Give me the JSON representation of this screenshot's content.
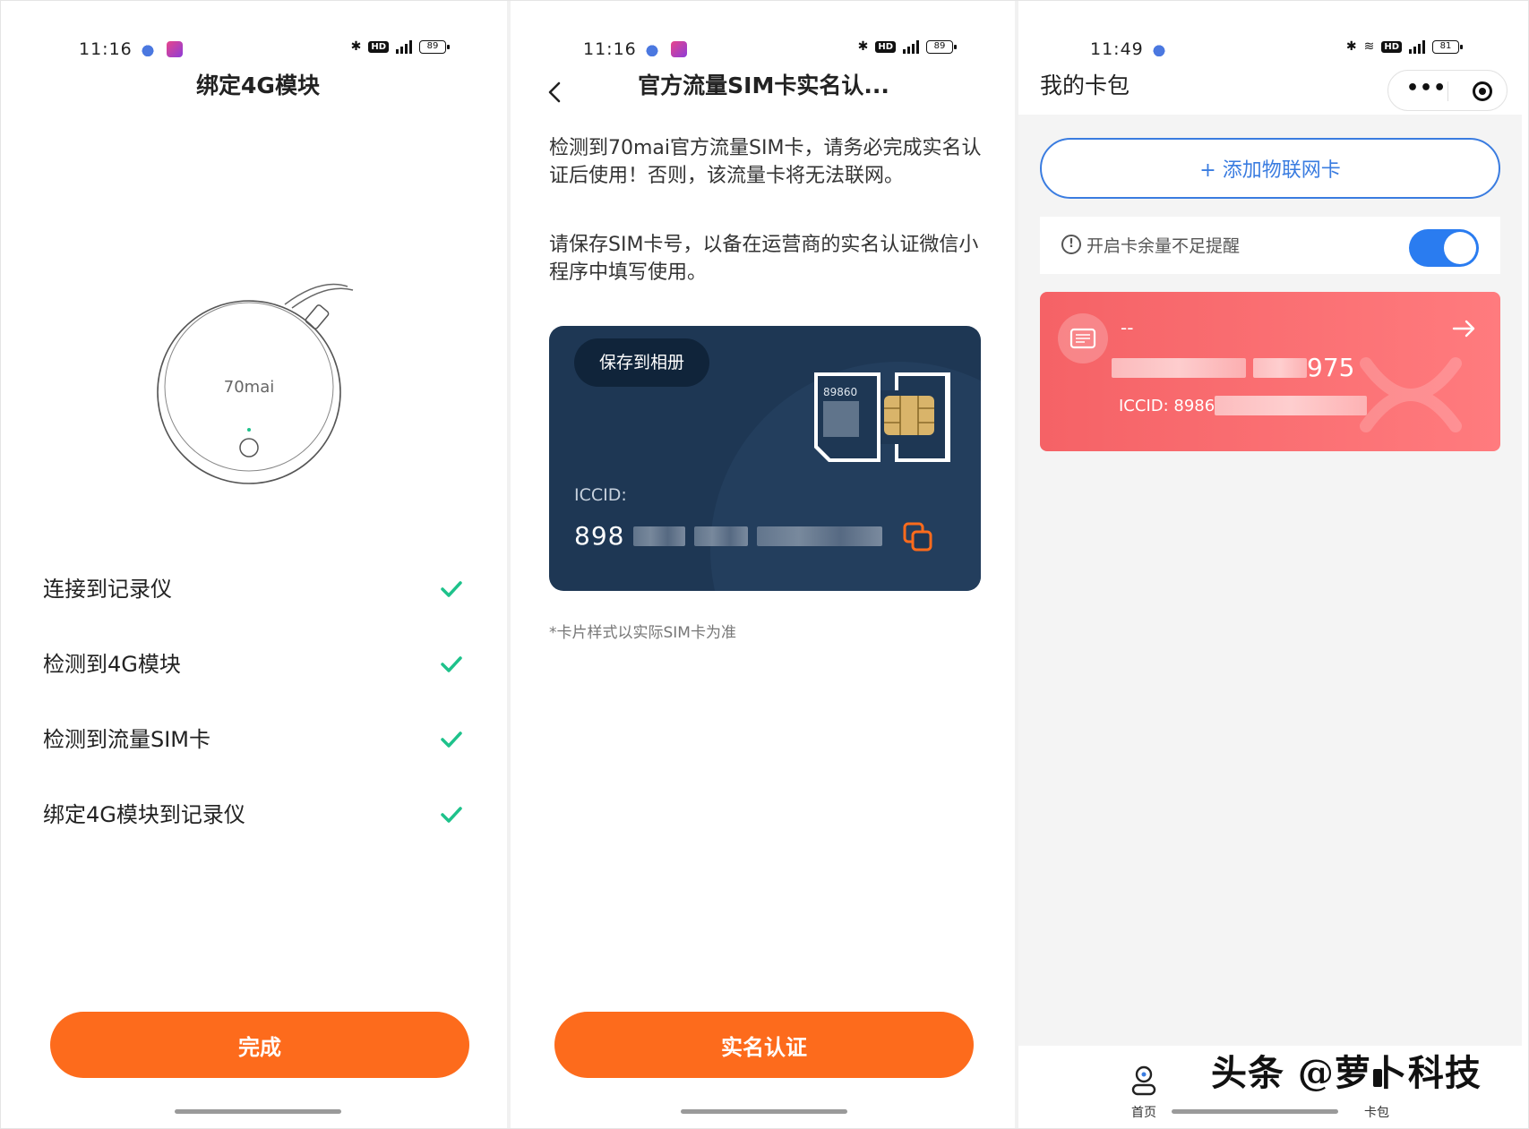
{
  "screens": {
    "bind": {
      "status": {
        "time": "11:16",
        "battery": "89"
      },
      "title": "绑定4G模块",
      "device_brand": "70mai",
      "steps": [
        {
          "label": "连接到记录仪",
          "done": true
        },
        {
          "label": "检测到4G模块",
          "done": true
        },
        {
          "label": "检测到流量SIM卡",
          "done": true
        },
        {
          "label": "绑定4G模块到记录仪",
          "done": true
        }
      ],
      "primary_button": "完成"
    },
    "verify": {
      "status": {
        "time": "11:16",
        "battery": "89"
      },
      "title": "官方流量SIM卡实名认...",
      "paragraph1": "检测到70mai官方流量SIM卡，请务必完成实名认证后使用！否则，该流量卡将无法联网。",
      "paragraph2": "请保存SIM卡号，以备在运营商的实名认证微信小程序中填写使用。",
      "save_button": "保存到相册",
      "iccid_label": "ICCID:",
      "iccid_prefix": "898",
      "chip_text": "89860",
      "note": "*卡片样式以实际SIM卡为准",
      "primary_button": "实名认证"
    },
    "wallet": {
      "status": {
        "time": "11:49",
        "battery": "81"
      },
      "title": "我的卡包",
      "capsule_more": "•••",
      "add_button": "+ 添加物联网卡",
      "reminder_label": "开启卡余量不足提醒",
      "reminder_on": true,
      "card": {
        "name": "--",
        "number_suffix": "975",
        "iccid_prefix": "ICCID: 8986"
      },
      "tabs": [
        {
          "label": "首页"
        },
        {
          "label": "卡包"
        }
      ],
      "watermark": "头条 @萝卜科技"
    }
  },
  "colors": {
    "accent_orange": "#fd6b1c",
    "check_green": "#1ec28b",
    "blue": "#3a7ce0",
    "card_navy": "#1e3754",
    "card_red": "#f56266"
  }
}
